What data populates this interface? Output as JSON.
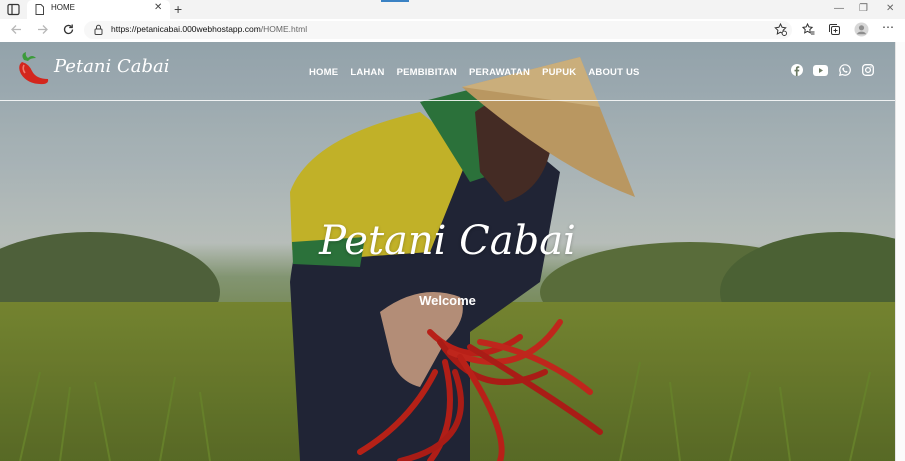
{
  "browser": {
    "tab_title": "HOME",
    "url_host": "https://petanicabai.000webhostapp.com",
    "url_path": "/HOME.html",
    "accent_color": "#3b82c4"
  },
  "site": {
    "brand": "Petani Cabai",
    "nav": [
      "HOME",
      "LAHAN",
      "PEMBIBITAN",
      "PERAWATAN",
      "PUPUK",
      "ABOUT US"
    ],
    "social_icons": [
      "facebook-icon",
      "youtube-icon",
      "whatsapp-icon",
      "instagram-icon"
    ],
    "hero_title": "Petani Cabai",
    "hero_subtitle": "Welcome",
    "chili_color": "#c8231b"
  }
}
